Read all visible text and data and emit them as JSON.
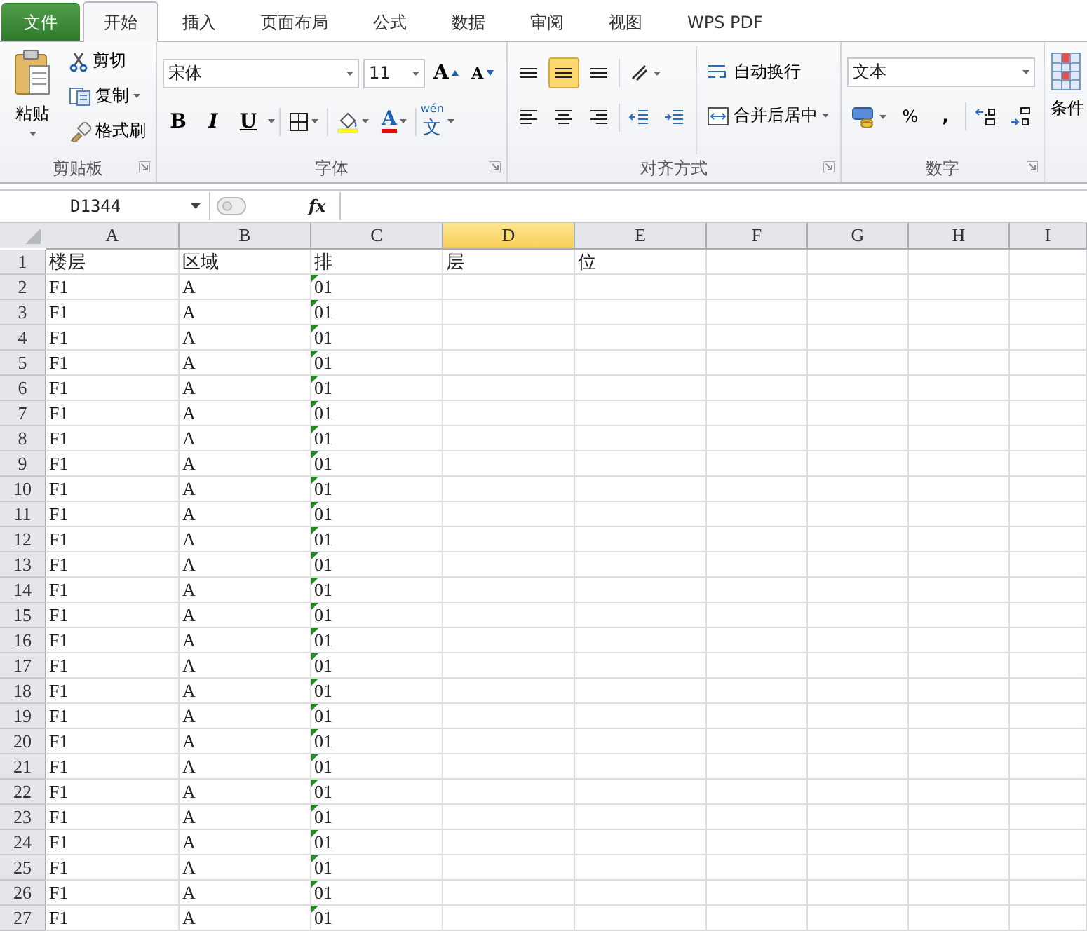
{
  "tabs": [
    {
      "label": "文件",
      "kind": "file",
      "selected": false
    },
    {
      "label": "开始",
      "kind": "tab",
      "selected": true
    },
    {
      "label": "插入",
      "kind": "tab",
      "selected": false
    },
    {
      "label": "页面布局",
      "kind": "tab",
      "selected": false
    },
    {
      "label": "公式",
      "kind": "tab",
      "selected": false
    },
    {
      "label": "数据",
      "kind": "tab",
      "selected": false
    },
    {
      "label": "审阅",
      "kind": "tab",
      "selected": false
    },
    {
      "label": "视图",
      "kind": "tab",
      "selected": false
    },
    {
      "label": "WPS PDF",
      "kind": "tab",
      "selected": false
    }
  ],
  "clipboard": {
    "label": "剪贴板",
    "paste": "粘贴",
    "cut": "剪切",
    "copy": "复制",
    "format_painter": "格式刷"
  },
  "font": {
    "label": "字体",
    "font_name": "宋体",
    "font_size": "11",
    "grow": "A",
    "shrink": "A",
    "bold": "B",
    "italic": "I",
    "underline": "U",
    "font_color": "A",
    "phonetic": "文",
    "phonetic_ruby": "wén"
  },
  "alignment": {
    "label": "对齐方式",
    "buttons": [
      {
        "kind": "top",
        "selected": false
      },
      {
        "kind": "middle",
        "selected": true
      },
      {
        "kind": "bottom",
        "selected": false
      },
      {
        "kind": "orient",
        "selected": false
      },
      {
        "kind": "left",
        "selected": false
      },
      {
        "kind": "center",
        "selected": false
      },
      {
        "kind": "right",
        "selected": false
      },
      {
        "kind": "outdent",
        "selected": false
      },
      {
        "kind": "indent",
        "selected": false
      }
    ],
    "wrap_text": "自动换行",
    "merge_center": "合并后居中"
  },
  "number": {
    "label": "数字",
    "format": "文本",
    "percent": "%",
    "comma": ","
  },
  "styles": {
    "conditional": "条件"
  },
  "formula_bar": {
    "name_box": "D1344",
    "fx": "fx"
  },
  "columns": [
    {
      "label": "A",
      "selected": false
    },
    {
      "label": "B",
      "selected": false
    },
    {
      "label": "C",
      "selected": false
    },
    {
      "label": "D",
      "selected": true
    },
    {
      "label": "E",
      "selected": false
    },
    {
      "label": "F",
      "selected": false
    },
    {
      "label": "G",
      "selected": false
    },
    {
      "label": "H",
      "selected": false
    },
    {
      "label": "I",
      "selected": false
    }
  ],
  "rows": [
    {
      "header": "1",
      "cells": [
        {
          "text": "楼层",
          "marker": false
        },
        {
          "text": "区域",
          "marker": false
        },
        {
          "text": "排",
          "marker": false
        },
        {
          "text": "层",
          "marker": false
        },
        {
          "text": "位",
          "marker": false
        }
      ]
    },
    {
      "header": "2",
      "cells": [
        {
          "text": "F1",
          "marker": false
        },
        {
          "text": "A",
          "marker": false
        },
        {
          "text": "01",
          "marker": true
        }
      ]
    },
    {
      "header": "3",
      "cells": [
        {
          "text": "F1",
          "marker": false
        },
        {
          "text": "A",
          "marker": false
        },
        {
          "text": "01",
          "marker": true
        }
      ]
    },
    {
      "header": "4",
      "cells": [
        {
          "text": "F1",
          "marker": false
        },
        {
          "text": "A",
          "marker": false
        },
        {
          "text": "01",
          "marker": true
        }
      ]
    },
    {
      "header": "5",
      "cells": [
        {
          "text": "F1",
          "marker": false
        },
        {
          "text": "A",
          "marker": false
        },
        {
          "text": "01",
          "marker": true
        }
      ]
    },
    {
      "header": "6",
      "cells": [
        {
          "text": "F1",
          "marker": false
        },
        {
          "text": "A",
          "marker": false
        },
        {
          "text": "01",
          "marker": true
        }
      ]
    },
    {
      "header": "7",
      "cells": [
        {
          "text": "F1",
          "marker": false
        },
        {
          "text": "A",
          "marker": false
        },
        {
          "text": "01",
          "marker": true
        }
      ]
    },
    {
      "header": "8",
      "cells": [
        {
          "text": "F1",
          "marker": false
        },
        {
          "text": "A",
          "marker": false
        },
        {
          "text": "01",
          "marker": true
        }
      ]
    },
    {
      "header": "9",
      "cells": [
        {
          "text": "F1",
          "marker": false
        },
        {
          "text": "A",
          "marker": false
        },
        {
          "text": "01",
          "marker": true
        }
      ]
    },
    {
      "header": "10",
      "cells": [
        {
          "text": "F1",
          "marker": false
        },
        {
          "text": "A",
          "marker": false
        },
        {
          "text": "01",
          "marker": true
        }
      ]
    },
    {
      "header": "11",
      "cells": [
        {
          "text": "F1",
          "marker": false
        },
        {
          "text": "A",
          "marker": false
        },
        {
          "text": "01",
          "marker": true
        }
      ]
    },
    {
      "header": "12",
      "cells": [
        {
          "text": "F1",
          "marker": false
        },
        {
          "text": "A",
          "marker": false
        },
        {
          "text": "01",
          "marker": true
        }
      ]
    },
    {
      "header": "13",
      "cells": [
        {
          "text": "F1",
          "marker": false
        },
        {
          "text": "A",
          "marker": false
        },
        {
          "text": "01",
          "marker": true
        }
      ]
    },
    {
      "header": "14",
      "cells": [
        {
          "text": "F1",
          "marker": false
        },
        {
          "text": "A",
          "marker": false
        },
        {
          "text": "01",
          "marker": true
        }
      ]
    },
    {
      "header": "15",
      "cells": [
        {
          "text": "F1",
          "marker": false
        },
        {
          "text": "A",
          "marker": false
        },
        {
          "text": "01",
          "marker": true
        }
      ]
    },
    {
      "header": "16",
      "cells": [
        {
          "text": "F1",
          "marker": false
        },
        {
          "text": "A",
          "marker": false
        },
        {
          "text": "01",
          "marker": true
        }
      ]
    },
    {
      "header": "17",
      "cells": [
        {
          "text": "F1",
          "marker": false
        },
        {
          "text": "A",
          "marker": false
        },
        {
          "text": "01",
          "marker": true
        }
      ]
    },
    {
      "header": "18",
      "cells": [
        {
          "text": "F1",
          "marker": false
        },
        {
          "text": "A",
          "marker": false
        },
        {
          "text": "01",
          "marker": true
        }
      ]
    },
    {
      "header": "19",
      "cells": [
        {
          "text": "F1",
          "marker": false
        },
        {
          "text": "A",
          "marker": false
        },
        {
          "text": "01",
          "marker": true
        }
      ]
    },
    {
      "header": "20",
      "cells": [
        {
          "text": "F1",
          "marker": false
        },
        {
          "text": "A",
          "marker": false
        },
        {
          "text": "01",
          "marker": true
        }
      ]
    },
    {
      "header": "21",
      "cells": [
        {
          "text": "F1",
          "marker": false
        },
        {
          "text": "A",
          "marker": false
        },
        {
          "text": "01",
          "marker": true
        }
      ]
    },
    {
      "header": "22",
      "cells": [
        {
          "text": "F1",
          "marker": false
        },
        {
          "text": "A",
          "marker": false
        },
        {
          "text": "01",
          "marker": true
        }
      ]
    },
    {
      "header": "23",
      "cells": [
        {
          "text": "F1",
          "marker": false
        },
        {
          "text": "A",
          "marker": false
        },
        {
          "text": "01",
          "marker": true
        }
      ]
    },
    {
      "header": "24",
      "cells": [
        {
          "text": "F1",
          "marker": false
        },
        {
          "text": "A",
          "marker": false
        },
        {
          "text": "01",
          "marker": true
        }
      ]
    },
    {
      "header": "25",
      "cells": [
        {
          "text": "F1",
          "marker": false
        },
        {
          "text": "A",
          "marker": false
        },
        {
          "text": "01",
          "marker": true
        }
      ]
    },
    {
      "header": "26",
      "cells": [
        {
          "text": "F1",
          "marker": false
        },
        {
          "text": "A",
          "marker": false
        },
        {
          "text": "01",
          "marker": true
        }
      ]
    },
    {
      "header": "27",
      "cells": [
        {
          "text": "F1",
          "marker": false
        },
        {
          "text": "A",
          "marker": false
        },
        {
          "text": "01",
          "marker": true
        }
      ]
    }
  ]
}
